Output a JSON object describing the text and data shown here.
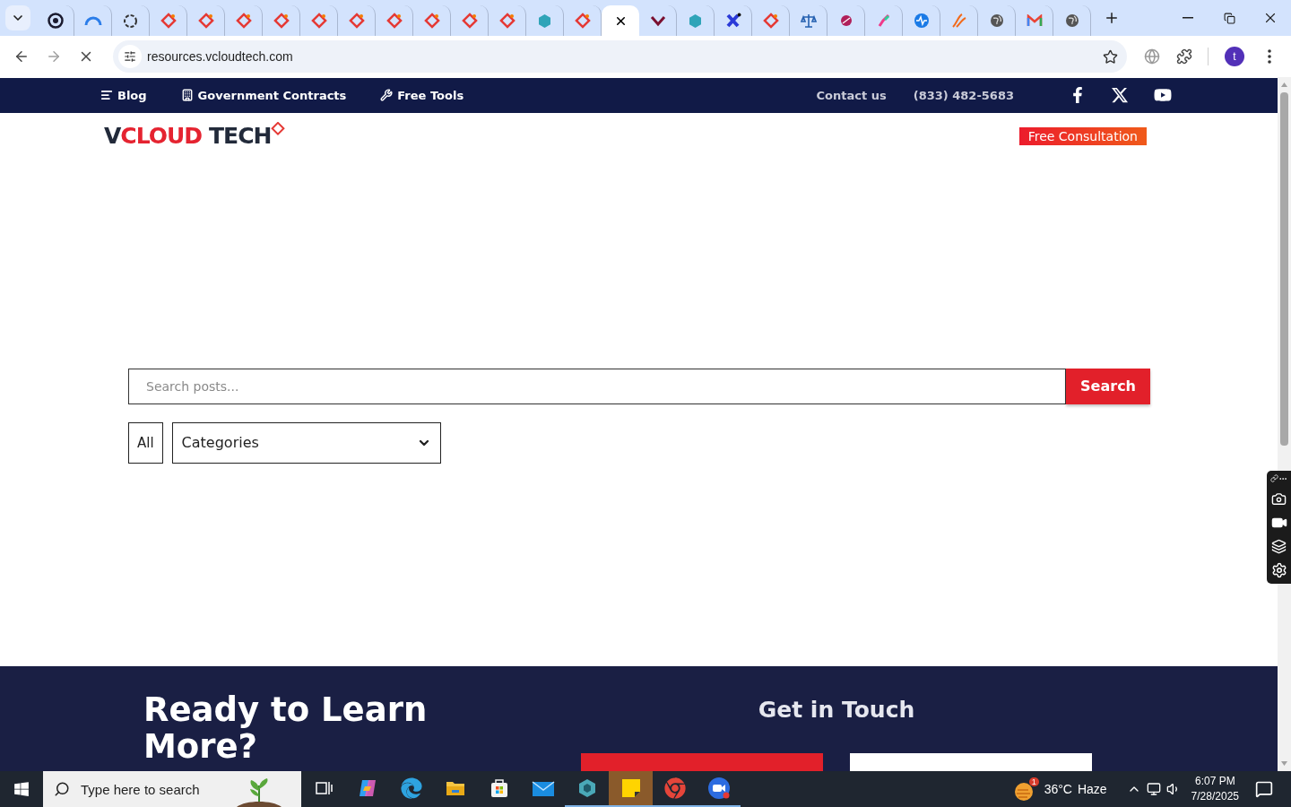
{
  "browser": {
    "tabs": [
      {
        "kind": "ring",
        "selected": false
      },
      {
        "kind": "gauge",
        "selected": false
      },
      {
        "kind": "knot",
        "selected": false
      },
      {
        "kind": "tag",
        "selected": false
      },
      {
        "kind": "tag",
        "selected": false
      },
      {
        "kind": "tag",
        "selected": false
      },
      {
        "kind": "tag",
        "selected": false
      },
      {
        "kind": "tag",
        "selected": false
      },
      {
        "kind": "tag",
        "selected": false
      },
      {
        "kind": "tag",
        "selected": false
      },
      {
        "kind": "tag",
        "selected": false
      },
      {
        "kind": "tag",
        "selected": false
      },
      {
        "kind": "tag",
        "selected": false
      },
      {
        "kind": "hexagon",
        "selected": false
      },
      {
        "kind": "tag",
        "selected": false
      },
      {
        "selected": true
      },
      {
        "kind": "check",
        "selected": false
      },
      {
        "kind": "hexagon",
        "selected": false
      },
      {
        "kind": "cross",
        "selected": false
      },
      {
        "kind": "tag",
        "selected": false
      },
      {
        "kind": "scales",
        "selected": false
      },
      {
        "kind": "ball",
        "selected": false
      },
      {
        "kind": "pen",
        "selected": false
      },
      {
        "kind": "pulse",
        "selected": false
      },
      {
        "kind": "swoosh",
        "selected": false
      },
      {
        "kind": "globe",
        "selected": false
      },
      {
        "kind": "mail",
        "selected": false
      },
      {
        "kind": "globe",
        "selected": false
      }
    ],
    "address": "resources.vcloudtech.com",
    "profile_initial": "t"
  },
  "site": {
    "topbar": {
      "links": [
        {
          "kind": "lines",
          "label": "Blog"
        },
        {
          "kind": "building",
          "label": "Government Contracts"
        },
        {
          "kind": "wrench",
          "label": "Free Tools"
        }
      ],
      "contact": "Contact us",
      "phone": "(833) 482-5683",
      "social": [
        {
          "kind": "facebook"
        },
        {
          "kind": "x"
        },
        {
          "kind": "youtube"
        }
      ]
    },
    "logo": {
      "lead": "V",
      "accent": "CLOUD",
      "tail": "TECH"
    },
    "cta": "Free Consultation",
    "search": {
      "placeholder": "Search posts...",
      "button": "Search"
    },
    "filters": {
      "all": "All",
      "categories": "Categories"
    },
    "footer": {
      "heading": "Ready to Learn More?",
      "contact_heading": "Get in Touch"
    }
  },
  "taskbar": {
    "search_placeholder": "Type here to search",
    "apps": [
      {
        "kind": "task-view",
        "running": false,
        "selected": false
      },
      {
        "kind": "copilot",
        "running": false,
        "selected": false
      },
      {
        "kind": "edge",
        "running": false,
        "selected": false
      },
      {
        "kind": "folder",
        "running": false,
        "selected": false
      },
      {
        "kind": "store",
        "running": false,
        "selected": false
      },
      {
        "kind": "mail",
        "running": false,
        "selected": false
      },
      {
        "kind": "hexagon",
        "running": true,
        "selected": false
      },
      {
        "kind": "note",
        "running": true,
        "selected": true
      },
      {
        "kind": "chrome",
        "running": true,
        "selected": false
      },
      {
        "kind": "zoom",
        "running": true,
        "selected": false
      }
    ],
    "weather": {
      "badge": "1",
      "temp": "36°C",
      "condition": "Haze"
    },
    "time": "6:07 PM",
    "date": "7/28/2025"
  }
}
